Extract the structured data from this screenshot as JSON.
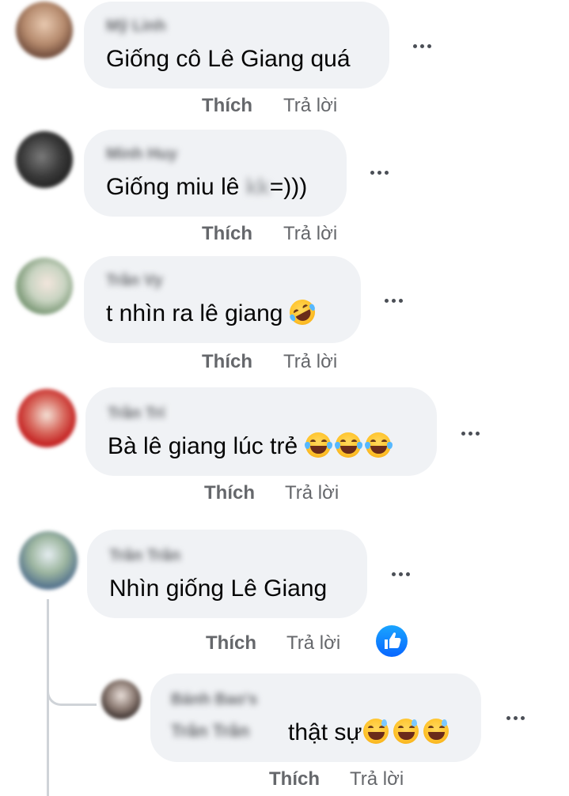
{
  "actions": {
    "like": "Thích",
    "reply": "Trả lời"
  },
  "icons": {
    "more": "more-horizontal-icon",
    "like_reaction": "like-reaction-icon",
    "rolling_laugh": "rolling-on-floor-laughing-emoji",
    "tears_of_joy": "face-with-tears-of-joy-emoji",
    "sweat_smile": "grinning-face-with-sweat-emoji"
  },
  "colors": {
    "bubble": "#f0f2f5",
    "action_text": "#65676b",
    "like_blue": "#0866ff",
    "thread_line": "#cfd3d8"
  },
  "comments": [
    {
      "author": "Mỹ Linh",
      "text": "Giống cô Lê Giang quá"
    },
    {
      "author": "Minh Huy",
      "text": "Giống miu lê ",
      "redacted": "kk",
      "text_after": "=)))"
    },
    {
      "author": "Trần Vy",
      "text": "t nhìn ra lê giang "
    },
    {
      "author": "Trần Trí",
      "text": "Bà lê giang lúc trẻ "
    },
    {
      "author": "Trân Trân",
      "text": "Nhìn giống Lê Giang"
    }
  ],
  "reply": {
    "author": "Bánh Bao's",
    "tagged": "Trân Trân",
    "text": "thật sự"
  }
}
